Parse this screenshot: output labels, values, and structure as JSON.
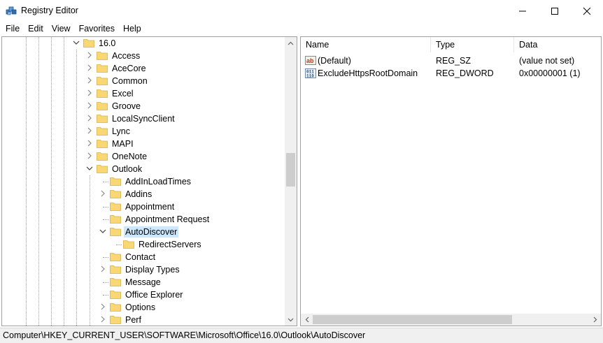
{
  "window": {
    "title": "Registry Editor",
    "icon": "registry-editor-icon",
    "controls": [
      "minimize-icon",
      "maximize-icon",
      "close-icon"
    ]
  },
  "menu": [
    "File",
    "Edit",
    "View",
    "Favorites",
    "Help"
  ],
  "tree": {
    "nodes": [
      {
        "label": "16.0",
        "depth": 0,
        "expander": "expanded"
      },
      {
        "label": "Access",
        "depth": 1,
        "expander": "collapsed"
      },
      {
        "label": "AceCore",
        "depth": 1,
        "expander": "collapsed"
      },
      {
        "label": "Common",
        "depth": 1,
        "expander": "collapsed"
      },
      {
        "label": "Excel",
        "depth": 1,
        "expander": "collapsed"
      },
      {
        "label": "Groove",
        "depth": 1,
        "expander": "collapsed"
      },
      {
        "label": "LocalSyncClient",
        "depth": 1,
        "expander": "collapsed"
      },
      {
        "label": "Lync",
        "depth": 1,
        "expander": "collapsed"
      },
      {
        "label": "MAPI",
        "depth": 1,
        "expander": "collapsed"
      },
      {
        "label": "OneNote",
        "depth": 1,
        "expander": "collapsed"
      },
      {
        "label": "Outlook",
        "depth": 1,
        "expander": "expanded"
      },
      {
        "label": "AddInLoadTimes",
        "depth": 2,
        "expander": "none"
      },
      {
        "label": "Addins",
        "depth": 2,
        "expander": "collapsed"
      },
      {
        "label": "Appointment",
        "depth": 2,
        "expander": "none"
      },
      {
        "label": "Appointment Request",
        "depth": 2,
        "expander": "none"
      },
      {
        "label": "AutoDiscover",
        "depth": 2,
        "expander": "expanded",
        "selected": true
      },
      {
        "label": "RedirectServers",
        "depth": 3,
        "expander": "none"
      },
      {
        "label": "Contact",
        "depth": 2,
        "expander": "none"
      },
      {
        "label": "Display Types",
        "depth": 2,
        "expander": "collapsed"
      },
      {
        "label": "Message",
        "depth": 2,
        "expander": "none"
      },
      {
        "label": "Office Explorer",
        "depth": 2,
        "expander": "none"
      },
      {
        "label": "Options",
        "depth": 2,
        "expander": "collapsed"
      },
      {
        "label": "Perf",
        "depth": 2,
        "expander": "collapsed"
      }
    ],
    "scroll_position": 0.45
  },
  "list": {
    "columns": [
      "Name",
      "Type",
      "Data"
    ],
    "rows": [
      {
        "icon": "string-value-icon",
        "name": "(Default)",
        "type": "REG_SZ",
        "data": "(value not set)"
      },
      {
        "icon": "binary-value-icon",
        "name": "ExcludeHttpsRootDomain",
        "type": "REG_DWORD",
        "data": "0x00000001 (1)"
      }
    ]
  },
  "status": {
    "path": "Computer\\HKEY_CURRENT_USER\\SOFTWARE\\Microsoft\\Office\\16.0\\Outlook\\AutoDiscover"
  },
  "colors": {
    "selection": "#cce8ff",
    "folder": "#f8d775",
    "folder_edge": "#dcb042",
    "border": "#a0a0a0",
    "scrollbar_track": "#f0f0f0",
    "scrollbar_thumb": "#cdcdcd"
  }
}
